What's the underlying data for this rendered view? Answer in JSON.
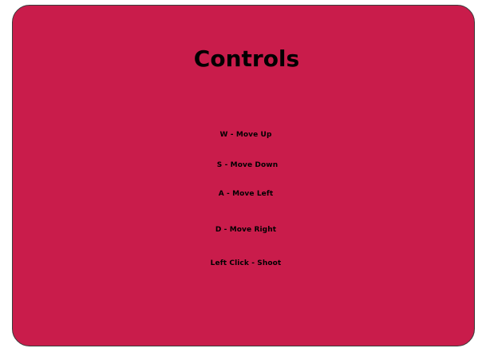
{
  "title": "Controls",
  "controls": [
    "W - Move Up",
    "S - Move Down",
    "A - Move Left",
    "D - Move Right",
    "Left Click - Shoot"
  ],
  "colors": {
    "panel_background": "#c91c4b",
    "text": "#000000",
    "page_background": "#ffffff"
  }
}
